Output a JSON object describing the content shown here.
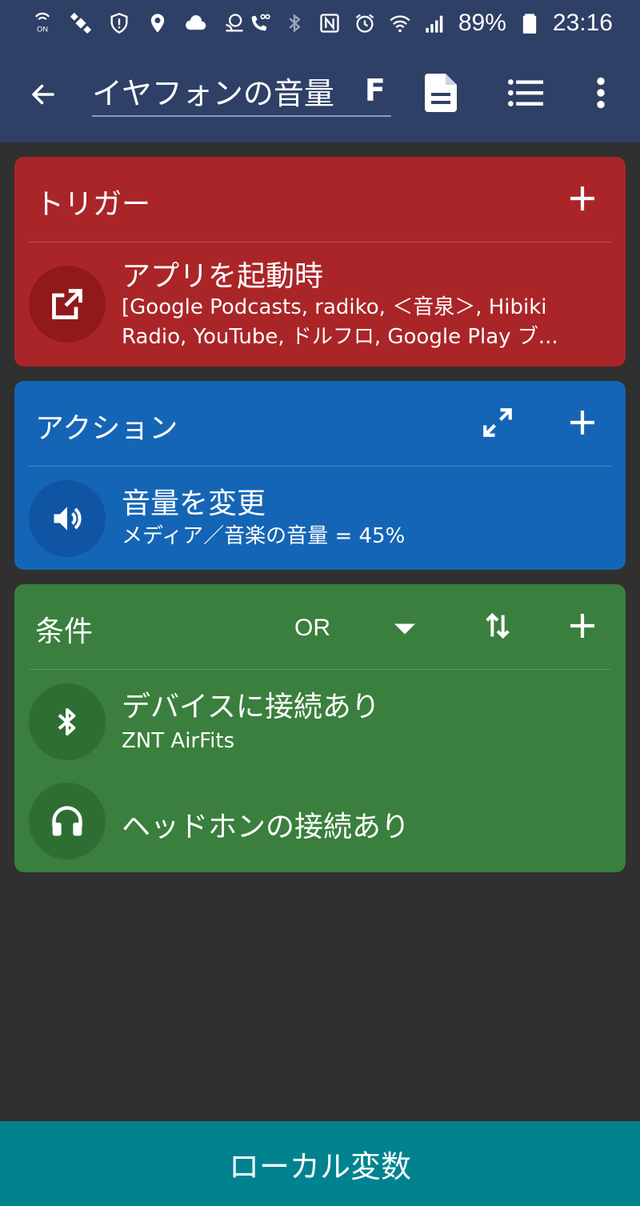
{
  "status_bar": {
    "battery": "89%",
    "clock": "23:16",
    "icons_left": [
      "nfc-on-icon",
      "satellite-icon",
      "shield-icon",
      "location-icon",
      "cloud-icon",
      "cast-icon"
    ],
    "icons_right": [
      "voicemail-call-icon",
      "bluetooth-icon",
      "nfc-icon",
      "alarm-icon",
      "wifi-icon",
      "signal-icon",
      "battery-icon"
    ]
  },
  "app_bar": {
    "title": "イヤフォンの音量",
    "title_overflow": "F",
    "background": "#2e4066"
  },
  "trigger": {
    "header": "トリガー",
    "color": "#aa2528",
    "item": {
      "title": "アプリを起動時",
      "subtitle": "[Google Podcasts, radiko, ＜音泉＞, Hibiki Radio, YouTube, ドルフロ, Google Play ブ...",
      "icon": "open-in-new-icon"
    }
  },
  "action": {
    "header": "アクション",
    "color": "#1565b6",
    "item": {
      "title": "音量を変更",
      "subtitle": "メディア／音楽の音量 = 45%",
      "icon": "volume-icon"
    }
  },
  "conditions": {
    "header": "条件",
    "operator": "OR",
    "color": "#3a7f3d",
    "items": [
      {
        "title": "デバイスに接続あり",
        "subtitle": "ZNT AirFits",
        "icon": "bluetooth-icon"
      },
      {
        "title": "ヘッドホンの接続あり",
        "icon": "headphones-icon"
      }
    ]
  },
  "bottom_bar": {
    "label": "ローカル変数",
    "color": "#00838f"
  }
}
